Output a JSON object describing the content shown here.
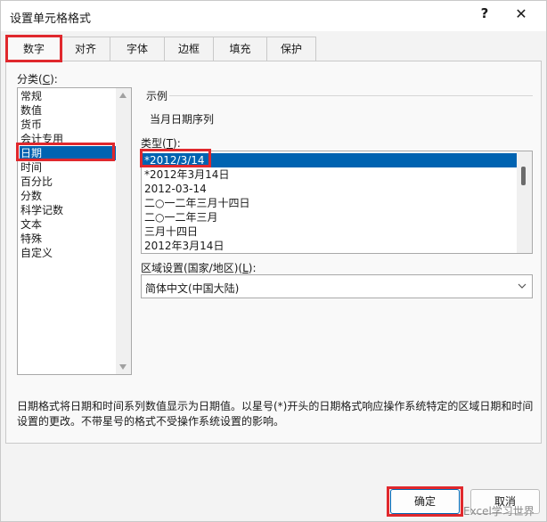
{
  "window": {
    "title": "设置单元格格式",
    "help_label": "?",
    "close_label": "✕"
  },
  "tabs": [
    {
      "label": "数字"
    },
    {
      "label": "对齐"
    },
    {
      "label": "字体"
    },
    {
      "label": "边框"
    },
    {
      "label": "填充"
    },
    {
      "label": "保护"
    }
  ],
  "category": {
    "label": "分类(",
    "hotkey": "C",
    "label_end": "):",
    "items": [
      "常规",
      "数值",
      "货币",
      "会计专用",
      "日期",
      "时间",
      "百分比",
      "分数",
      "科学记数",
      "文本",
      "特殊",
      "自定义"
    ],
    "selected": "日期"
  },
  "sample": {
    "label": "示例",
    "value": "当月日期序列"
  },
  "type": {
    "label": "类型(",
    "hotkey": "T",
    "label_end": "):",
    "items": [
      "*2012/3/14",
      "*2012年3月14日",
      "2012-03-14",
      "二○一二年三月十四日",
      "二○一二年三月",
      "三月十四日",
      "2012年3月14日"
    ],
    "selected": "*2012/3/14"
  },
  "locale": {
    "label": "区域设置(国家/地区)(",
    "hotkey": "L",
    "label_end": "):",
    "value": "简体中文(中国大陆)"
  },
  "description": {
    "line1": "日期格式将日期和时间系列数值显示为日期值。以星号(*)开头的日期格式响应操作系统特定的区域日期和时间",
    "line2": "设置的更改。不带星号的格式不受操作系统设置的影响。"
  },
  "buttons": {
    "ok": "确定",
    "cancel": "取消"
  },
  "watermark": "Excel学习世界",
  "colors": {
    "selection": "#0063b1",
    "highlight_box": "#e0282d"
  }
}
